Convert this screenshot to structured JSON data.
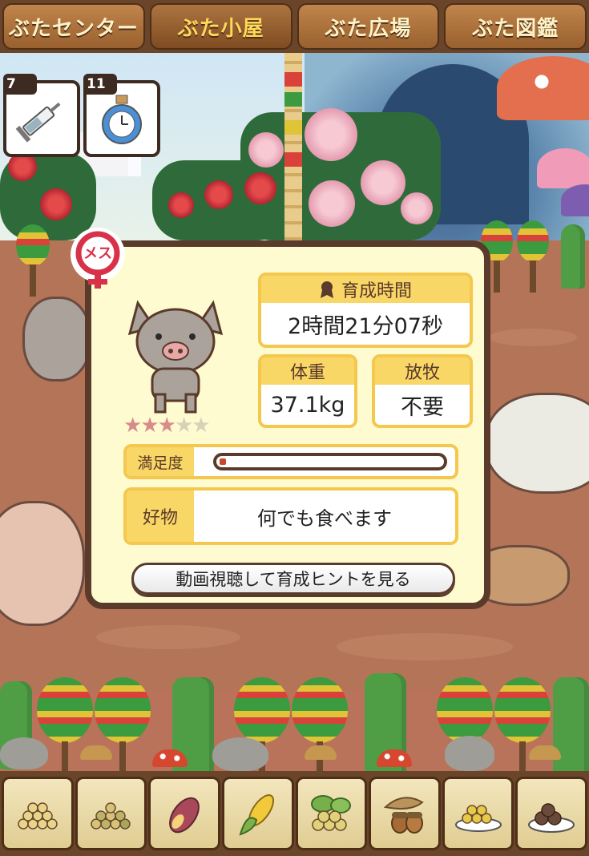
{
  "top_tabs": [
    {
      "label": "ぶたセンター",
      "active": false
    },
    {
      "label": "ぶた小屋",
      "active": true
    },
    {
      "label": "ぶた広場",
      "active": false
    },
    {
      "label": "ぶた図鑑",
      "active": false
    }
  ],
  "items": [
    {
      "count": "7",
      "icon": "syringe-icon"
    },
    {
      "count": "11",
      "icon": "potion-clock-icon"
    }
  ],
  "pig": {
    "gender_label": "メス",
    "rating": 3,
    "rating_max": 5,
    "growth_time": {
      "label": "育成時間",
      "value": "2時間21分07秒"
    },
    "weight": {
      "label": "体重",
      "value": "37.1kg"
    },
    "grazing": {
      "label": "放牧",
      "value": "不要"
    },
    "satisfaction": {
      "label": "満足度",
      "level": 0.03
    },
    "favorite": {
      "label": "好物",
      "value": "何でも食べます"
    },
    "hint_button": "動画視聴して育成ヒントを見る"
  },
  "food_bar": [
    {
      "icon": "grain-pile-icon"
    },
    {
      "icon": "mixed-grain-icon"
    },
    {
      "icon": "sweet-potato-icon"
    },
    {
      "icon": "corn-icon"
    },
    {
      "icon": "leafy-seeds-icon"
    },
    {
      "icon": "acorn-icon"
    },
    {
      "icon": "grain-bowl-icon"
    },
    {
      "icon": "meatball-plate-icon"
    }
  ],
  "colors": {
    "frame": "#5a3a2b",
    "card": "#fefbd0",
    "accent_yellow": "#f9d766",
    "gender_red": "#d8324a",
    "ground": "#b47457"
  }
}
